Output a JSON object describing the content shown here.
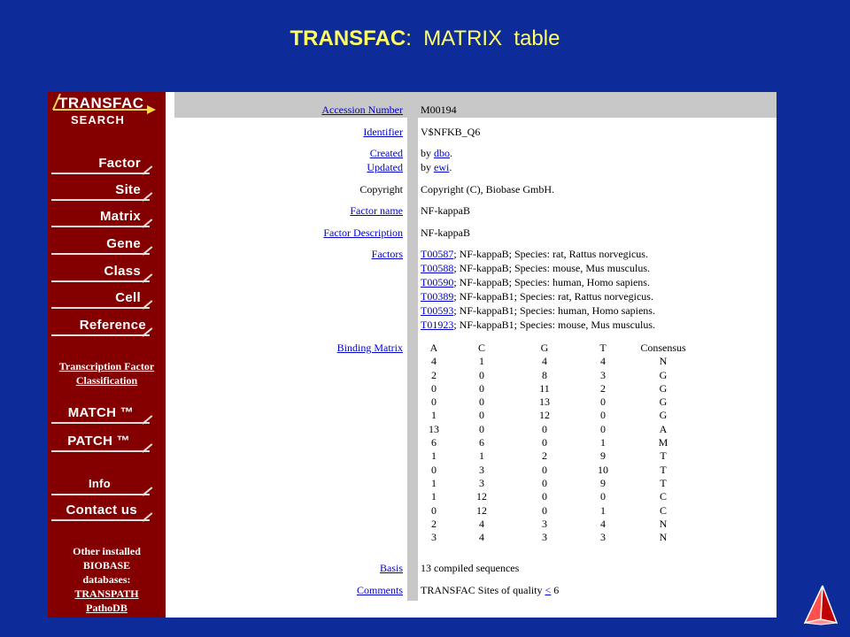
{
  "slide": {
    "title_bold": "TRANSFAC",
    "title_rest": ":  MATRIX  table"
  },
  "logo": {
    "line1": "TRANSFAC",
    "line2": "SEARCH"
  },
  "nav": [
    "Factor",
    "Site",
    "Matrix",
    "Gene",
    "Class",
    "Cell",
    "Reference"
  ],
  "tfc": {
    "line1": "Transcription Factor",
    "line2": "Classification"
  },
  "tools": [
    "MATCH ™",
    "PATCH ™"
  ],
  "nav2": [
    "Info",
    "Contact us"
  ],
  "other": {
    "lines": [
      "Other installed",
      "BIOBASE",
      "databases:"
    ],
    "links": [
      "TRANSPATH",
      "PathoDB"
    ]
  },
  "fields": {
    "accession": {
      "label": "Accession Number",
      "value": "M00194"
    },
    "identifier": {
      "label": "Identifier",
      "value": "V$NFKB_Q6"
    },
    "created": {
      "label": "Created",
      "prefix": "by ",
      "link": "dbo",
      "suffix": "."
    },
    "updated": {
      "label": "Updated",
      "prefix": "by ",
      "link": "ewi",
      "suffix": "."
    },
    "copyright": {
      "label": "Copyright",
      "value": "Copyright (C), Biobase GmbH."
    },
    "factor_name": {
      "label": "Factor name",
      "value": "NF-kappaB"
    },
    "factor_desc": {
      "label": "Factor Description",
      "value": "NF-kappaB"
    },
    "factors_label": "Factors",
    "factors": [
      {
        "id": "T00587",
        "text": "; NF-kappaB; Species: rat, Rattus norvegicus."
      },
      {
        "id": "T00588",
        "text": "; NF-kappaB; Species: mouse, Mus musculus."
      },
      {
        "id": "T00590",
        "text": "; NF-kappaB; Species: human, Homo sapiens."
      },
      {
        "id": "T00389",
        "text": "; NF-kappaB1; Species: rat, Rattus norvegicus."
      },
      {
        "id": "T00593",
        "text": "; NF-kappaB1; Species: human, Homo sapiens."
      },
      {
        "id": "T01923",
        "text": "; NF-kappaB1; Species: mouse, Mus musculus."
      }
    ],
    "binding_label": "Binding Matrix",
    "matrix_headers": [
      "A",
      "C",
      "G",
      "T",
      "Consensus"
    ],
    "matrix_rows": [
      [
        "4",
        "1",
        "4",
        "4",
        "N"
      ],
      [
        "2",
        "0",
        "8",
        "3",
        "G"
      ],
      [
        "0",
        "0",
        "11",
        "2",
        "G"
      ],
      [
        "0",
        "0",
        "13",
        "0",
        "G"
      ],
      [
        "1",
        "0",
        "12",
        "0",
        "G"
      ],
      [
        "13",
        "0",
        "0",
        "0",
        "A"
      ],
      [
        "6",
        "6",
        "0",
        "1",
        "M"
      ],
      [
        "1",
        "1",
        "2",
        "9",
        "T"
      ],
      [
        "0",
        "3",
        "0",
        "10",
        "T"
      ],
      [
        "1",
        "3",
        "0",
        "9",
        "T"
      ],
      [
        "1",
        "12",
        "0",
        "0",
        "C"
      ],
      [
        "0",
        "12",
        "0",
        "1",
        "C"
      ],
      [
        "2",
        "4",
        "3",
        "4",
        "N"
      ],
      [
        "3",
        "4",
        "3",
        "3",
        "N"
      ]
    ],
    "basis": {
      "label": "Basis",
      "value": "13 compiled sequences"
    },
    "comments": {
      "label": "Comments",
      "prefix": "TRANSFAC Sites of quality ",
      "link": "<",
      "suffix": " 6"
    }
  },
  "colors": {
    "slide_bg": "#0d2c9a",
    "title": "#ffff66",
    "sidebar": "#840000",
    "link": "#0000cc",
    "band": "#c8c8c8"
  },
  "icons": {
    "corner": "red-pyramid-icon"
  }
}
